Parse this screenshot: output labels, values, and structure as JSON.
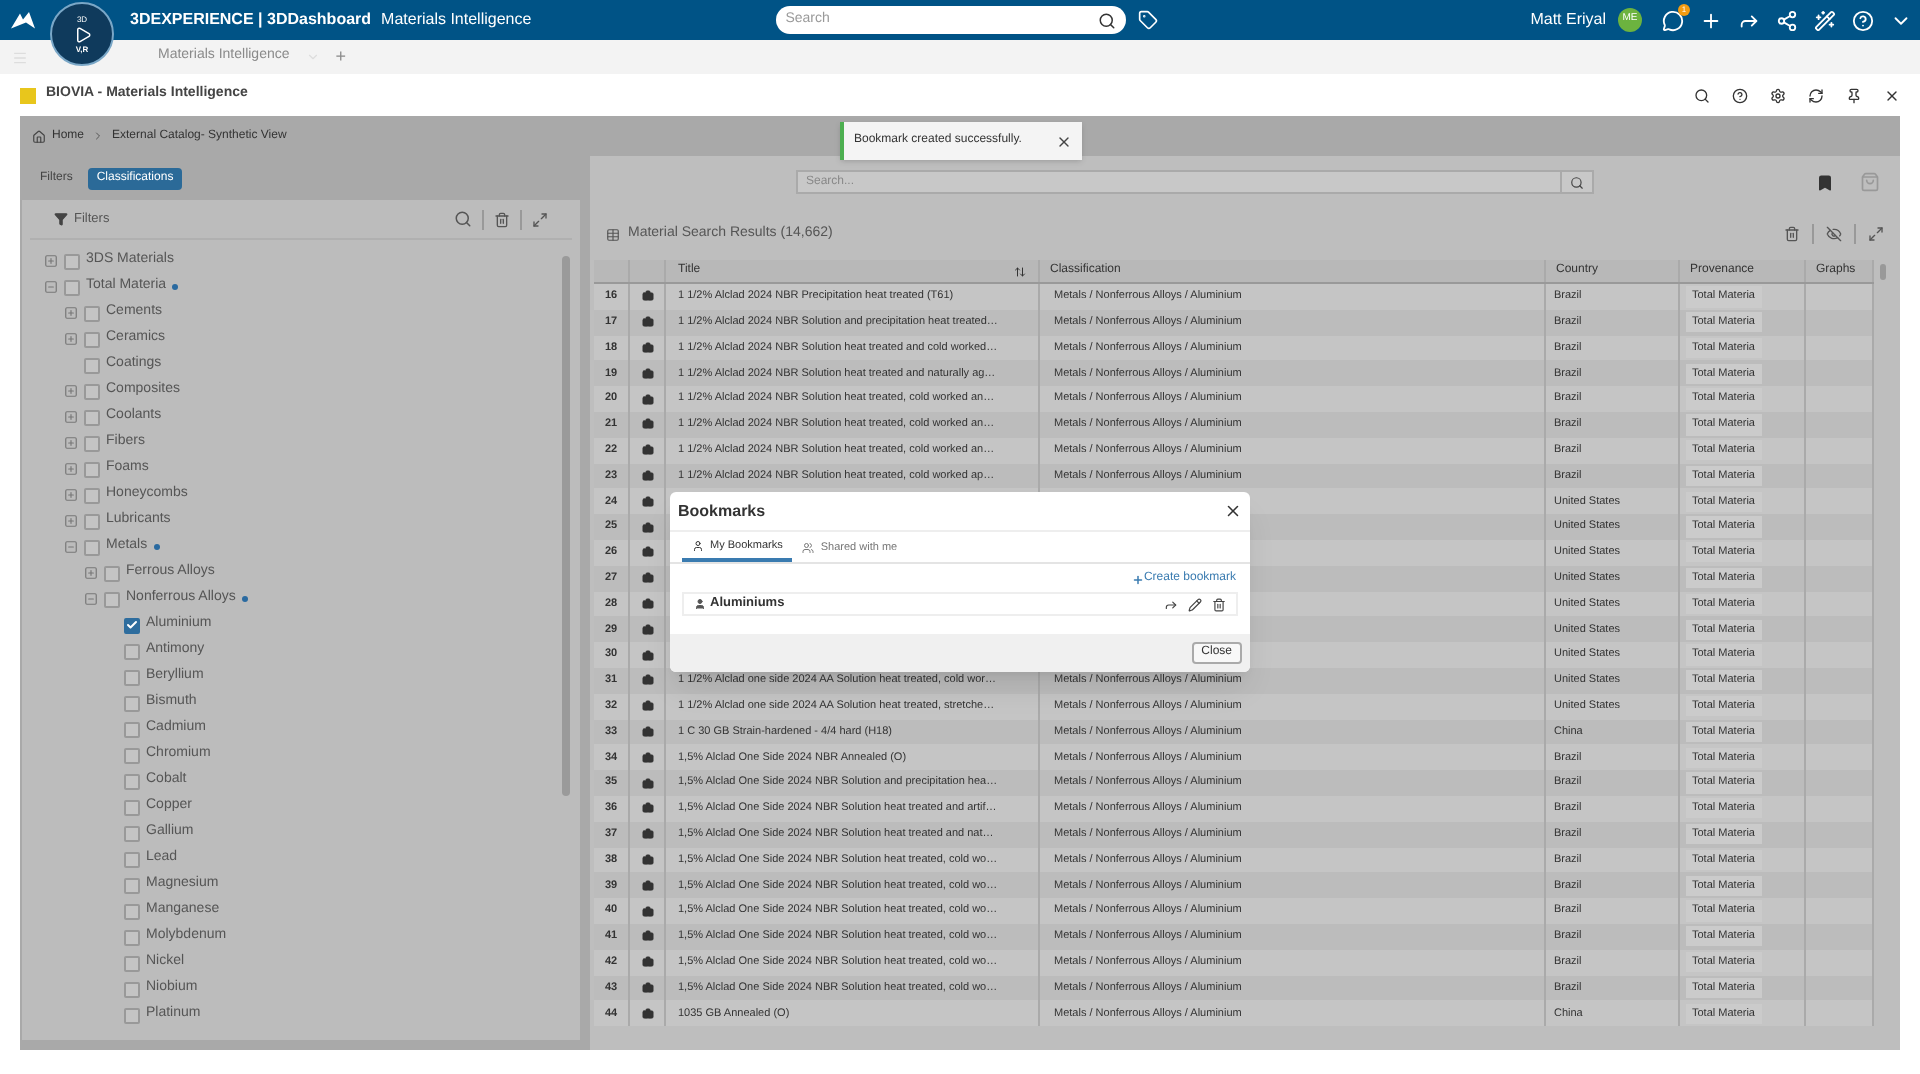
{
  "top_bar": {
    "compass": {
      "top": "3D",
      "bottom": "V,R"
    },
    "brand": "3DEXPERIENCE",
    "separator": "|",
    "app": "3DDashboard",
    "dashboard": "Materials Intelligence",
    "search": {
      "placeholder": "Search"
    },
    "user": "Matt Eriyal",
    "avatar": "ME",
    "notifications": "1"
  },
  "dashboard_bar": {
    "tab": "Materials Intelligence",
    "add": "+"
  },
  "widget": {
    "title": "BIOVIA - Materials Intelligence"
  },
  "breadcrumb": [
    "Home",
    "External Catalog- Synthetic View"
  ],
  "toast": {
    "message": "Bookmark created successfully."
  },
  "left_tabs": [
    {
      "label": "Filters",
      "selected": false
    },
    {
      "label": "Classifications",
      "selected": true
    }
  ],
  "filters": {
    "title": "Filters"
  },
  "tree": [
    {
      "label": "3DS Materials",
      "kind": "folder",
      "expanded": false,
      "checked": false,
      "marked": false
    },
    {
      "label": "Total Materia",
      "kind": "folder",
      "expanded": true,
      "checked": false,
      "marked": true,
      "children": [
        {
          "label": "Cements",
          "kind": "folder",
          "expanded": false,
          "checked": false,
          "marked": false
        },
        {
          "label": "Ceramics",
          "kind": "folder",
          "expanded": false,
          "checked": false,
          "marked": false
        },
        {
          "label": "Coatings",
          "kind": "leaf",
          "checked": false,
          "marked": false
        },
        {
          "label": "Composites",
          "kind": "folder",
          "expanded": false,
          "checked": false,
          "marked": false
        },
        {
          "label": "Coolants",
          "kind": "folder",
          "expanded": false,
          "checked": false,
          "marked": false
        },
        {
          "label": "Fibers",
          "kind": "folder",
          "expanded": false,
          "checked": false,
          "marked": false
        },
        {
          "label": "Foams",
          "kind": "folder",
          "expanded": false,
          "checked": false,
          "marked": false
        },
        {
          "label": "Honeycombs",
          "kind": "folder",
          "expanded": false,
          "checked": false,
          "marked": false
        },
        {
          "label": "Lubricants",
          "kind": "folder",
          "expanded": false,
          "checked": false,
          "marked": false
        },
        {
          "label": "Metals",
          "kind": "folder",
          "expanded": true,
          "checked": false,
          "marked": true,
          "children": [
            {
              "label": "Ferrous Alloys",
              "kind": "folder",
              "expanded": false,
              "checked": false,
              "marked": false
            },
            {
              "label": "Nonferrous Alloys",
              "kind": "folder",
              "expanded": true,
              "checked": false,
              "marked": true,
              "children": [
                {
                  "label": "Aluminium",
                  "kind": "leaf",
                  "checked": true,
                  "marked": false
                },
                {
                  "label": "Antimony",
                  "kind": "leaf",
                  "checked": false,
                  "marked": false
                },
                {
                  "label": "Beryllium",
                  "kind": "leaf",
                  "checked": false,
                  "marked": false
                },
                {
                  "label": "Bismuth",
                  "kind": "leaf",
                  "checked": false,
                  "marked": false
                },
                {
                  "label": "Cadmium",
                  "kind": "leaf",
                  "checked": false,
                  "marked": false
                },
                {
                  "label": "Chromium",
                  "kind": "leaf",
                  "checked": false,
                  "marked": false
                },
                {
                  "label": "Cobalt",
                  "kind": "leaf",
                  "checked": false,
                  "marked": false
                },
                {
                  "label": "Copper",
                  "kind": "leaf",
                  "checked": false,
                  "marked": false
                },
                {
                  "label": "Gallium",
                  "kind": "leaf",
                  "checked": false,
                  "marked": false
                },
                {
                  "label": "Lead",
                  "kind": "leaf",
                  "checked": false,
                  "marked": false
                },
                {
                  "label": "Magnesium",
                  "kind": "leaf",
                  "checked": false,
                  "marked": false
                },
                {
                  "label": "Manganese",
                  "kind": "leaf",
                  "checked": false,
                  "marked": false
                },
                {
                  "label": "Molybdenum",
                  "kind": "leaf",
                  "checked": false,
                  "marked": false
                },
                {
                  "label": "Nickel",
                  "kind": "leaf",
                  "checked": false,
                  "marked": false
                },
                {
                  "label": "Niobium",
                  "kind": "leaf",
                  "checked": false,
                  "marked": false
                },
                {
                  "label": "Platinum",
                  "kind": "leaf",
                  "checked": false,
                  "marked": false
                }
              ]
            }
          ]
        }
      ]
    }
  ],
  "search": {
    "placeholder": "Search..."
  },
  "results": {
    "title": "Material Search Results (14,662)"
  },
  "table": {
    "columns": [
      "Title",
      "Classification",
      "Country",
      "Provenance",
      "Graphs"
    ],
    "rows": [
      {
        "n": "16",
        "title": "1 1/2% Alclad 2024 NBR Precipitation heat treated (T61)",
        "classification": "Metals / Nonferrous Alloys / Aluminium",
        "country": "Brazil",
        "provenance": "Total Materia"
      },
      {
        "n": "17",
        "title": "1 1/2% Alclad 2024 NBR Solution and precipitation heat treated…",
        "classification": "Metals / Nonferrous Alloys / Aluminium",
        "country": "Brazil",
        "provenance": "Total Materia"
      },
      {
        "n": "18",
        "title": "1 1/2% Alclad 2024 NBR Solution heat treated and cold worked…",
        "classification": "Metals / Nonferrous Alloys / Aluminium",
        "country": "Brazil",
        "provenance": "Total Materia"
      },
      {
        "n": "19",
        "title": "1 1/2% Alclad 2024 NBR Solution heat treated and naturally ag…",
        "classification": "Metals / Nonferrous Alloys / Aluminium",
        "country": "Brazil",
        "provenance": "Total Materia"
      },
      {
        "n": "20",
        "title": "1 1/2% Alclad 2024 NBR Solution heat treated, cold worked an…",
        "classification": "Metals / Nonferrous Alloys / Aluminium",
        "country": "Brazil",
        "provenance": "Total Materia"
      },
      {
        "n": "21",
        "title": "1 1/2% Alclad 2024 NBR Solution heat treated, cold worked an…",
        "classification": "Metals / Nonferrous Alloys / Aluminium",
        "country": "Brazil",
        "provenance": "Total Materia"
      },
      {
        "n": "22",
        "title": "1 1/2% Alclad 2024 NBR Solution heat treated, cold worked an…",
        "classification": "Metals / Nonferrous Alloys / Aluminium",
        "country": "Brazil",
        "provenance": "Total Materia"
      },
      {
        "n": "23",
        "title": "1 1/2% Alclad 2024 NBR Solution heat treated, cold worked ap…",
        "classification": "Metals / Nonferrous Alloys / Aluminium",
        "country": "Brazil",
        "provenance": "Total Materia"
      },
      {
        "n": "24",
        "country": "United States",
        "provenance": "Total Materia"
      },
      {
        "n": "25",
        "country": "United States",
        "provenance": "Total Materia"
      },
      {
        "n": "26",
        "country": "United States",
        "provenance": "Total Materia"
      },
      {
        "n": "27",
        "country": "United States",
        "provenance": "Total Materia"
      },
      {
        "n": "28",
        "country": "United States",
        "provenance": "Total Materia"
      },
      {
        "n": "29",
        "country": "United States",
        "provenance": "Total Materia"
      },
      {
        "n": "30",
        "country": "United States",
        "provenance": "Total Materia"
      },
      {
        "n": "31",
        "title": "1 1/2% Alclad one side 2024 AA Solution heat treated, cold wor…",
        "classification": "Metals / Nonferrous Alloys / Aluminium",
        "country": "United States",
        "provenance": "Total Materia"
      },
      {
        "n": "32",
        "title": "1 1/2% Alclad one side 2024 AA Solution heat treated, stretche…",
        "classification": "Metals / Nonferrous Alloys / Aluminium",
        "country": "United States",
        "provenance": "Total Materia"
      },
      {
        "n": "33",
        "title": "1 C 30 GB Strain-hardened - 4/4 hard (H18)",
        "classification": "Metals / Nonferrous Alloys / Aluminium",
        "country": "China",
        "provenance": "Total Materia"
      },
      {
        "n": "34",
        "title": "1,5% Alclad One Side 2024 NBR Annealed (O)",
        "classification": "Metals / Nonferrous Alloys / Aluminium",
        "country": "Brazil",
        "provenance": "Total Materia"
      },
      {
        "n": "35",
        "title": "1,5% Alclad One Side 2024 NBR Solution and precipitation hea…",
        "classification": "Metals / Nonferrous Alloys / Aluminium",
        "country": "Brazil",
        "provenance": "Total Materia"
      },
      {
        "n": "36",
        "title": "1,5% Alclad One Side 2024 NBR Solution heat treated and artif…",
        "classification": "Metals / Nonferrous Alloys / Aluminium",
        "country": "Brazil",
        "provenance": "Total Materia"
      },
      {
        "n": "37",
        "title": "1,5% Alclad One Side 2024 NBR Solution heat treated and nat…",
        "classification": "Metals / Nonferrous Alloys / Aluminium",
        "country": "Brazil",
        "provenance": "Total Materia"
      },
      {
        "n": "38",
        "title": "1,5% Alclad One Side 2024 NBR Solution heat treated, cold wo…",
        "classification": "Metals / Nonferrous Alloys / Aluminium",
        "country": "Brazil",
        "provenance": "Total Materia"
      },
      {
        "n": "39",
        "title": "1,5% Alclad One Side 2024 NBR Solution heat treated, cold wo…",
        "classification": "Metals / Nonferrous Alloys / Aluminium",
        "country": "Brazil",
        "provenance": "Total Materia"
      },
      {
        "n": "40",
        "title": "1,5% Alclad One Side 2024 NBR Solution heat treated, cold wo…",
        "classification": "Metals / Nonferrous Alloys / Aluminium",
        "country": "Brazil",
        "provenance": "Total Materia"
      },
      {
        "n": "41",
        "title": "1,5% Alclad One Side 2024 NBR Solution heat treated, cold wo…",
        "classification": "Metals / Nonferrous Alloys / Aluminium",
        "country": "Brazil",
        "provenance": "Total Materia"
      },
      {
        "n": "42",
        "title": "1,5% Alclad One Side 2024 NBR Solution heat treated, cold wo…",
        "classification": "Metals / Nonferrous Alloys / Aluminium",
        "country": "Brazil",
        "provenance": "Total Materia"
      },
      {
        "n": "43",
        "title": "1,5% Alclad One Side 2024 NBR Solution heat treated, cold wo…",
        "classification": "Metals / Nonferrous Alloys / Aluminium",
        "country": "Brazil",
        "provenance": "Total Materia"
      },
      {
        "n": "44",
        "title": "1035 GB Annealed (O)",
        "classification": "Metals / Nonferrous Alloys / Aluminium",
        "country": "China",
        "provenance": "Total Materia"
      }
    ]
  },
  "dialog": {
    "title": "Bookmarks",
    "tabs": [
      {
        "label": "My Bookmarks",
        "selected": true
      },
      {
        "label": "Shared with me",
        "selected": false
      }
    ],
    "create": "Create bookmark",
    "bookmarks": [
      "Aluminiums"
    ],
    "close": "Close"
  }
}
